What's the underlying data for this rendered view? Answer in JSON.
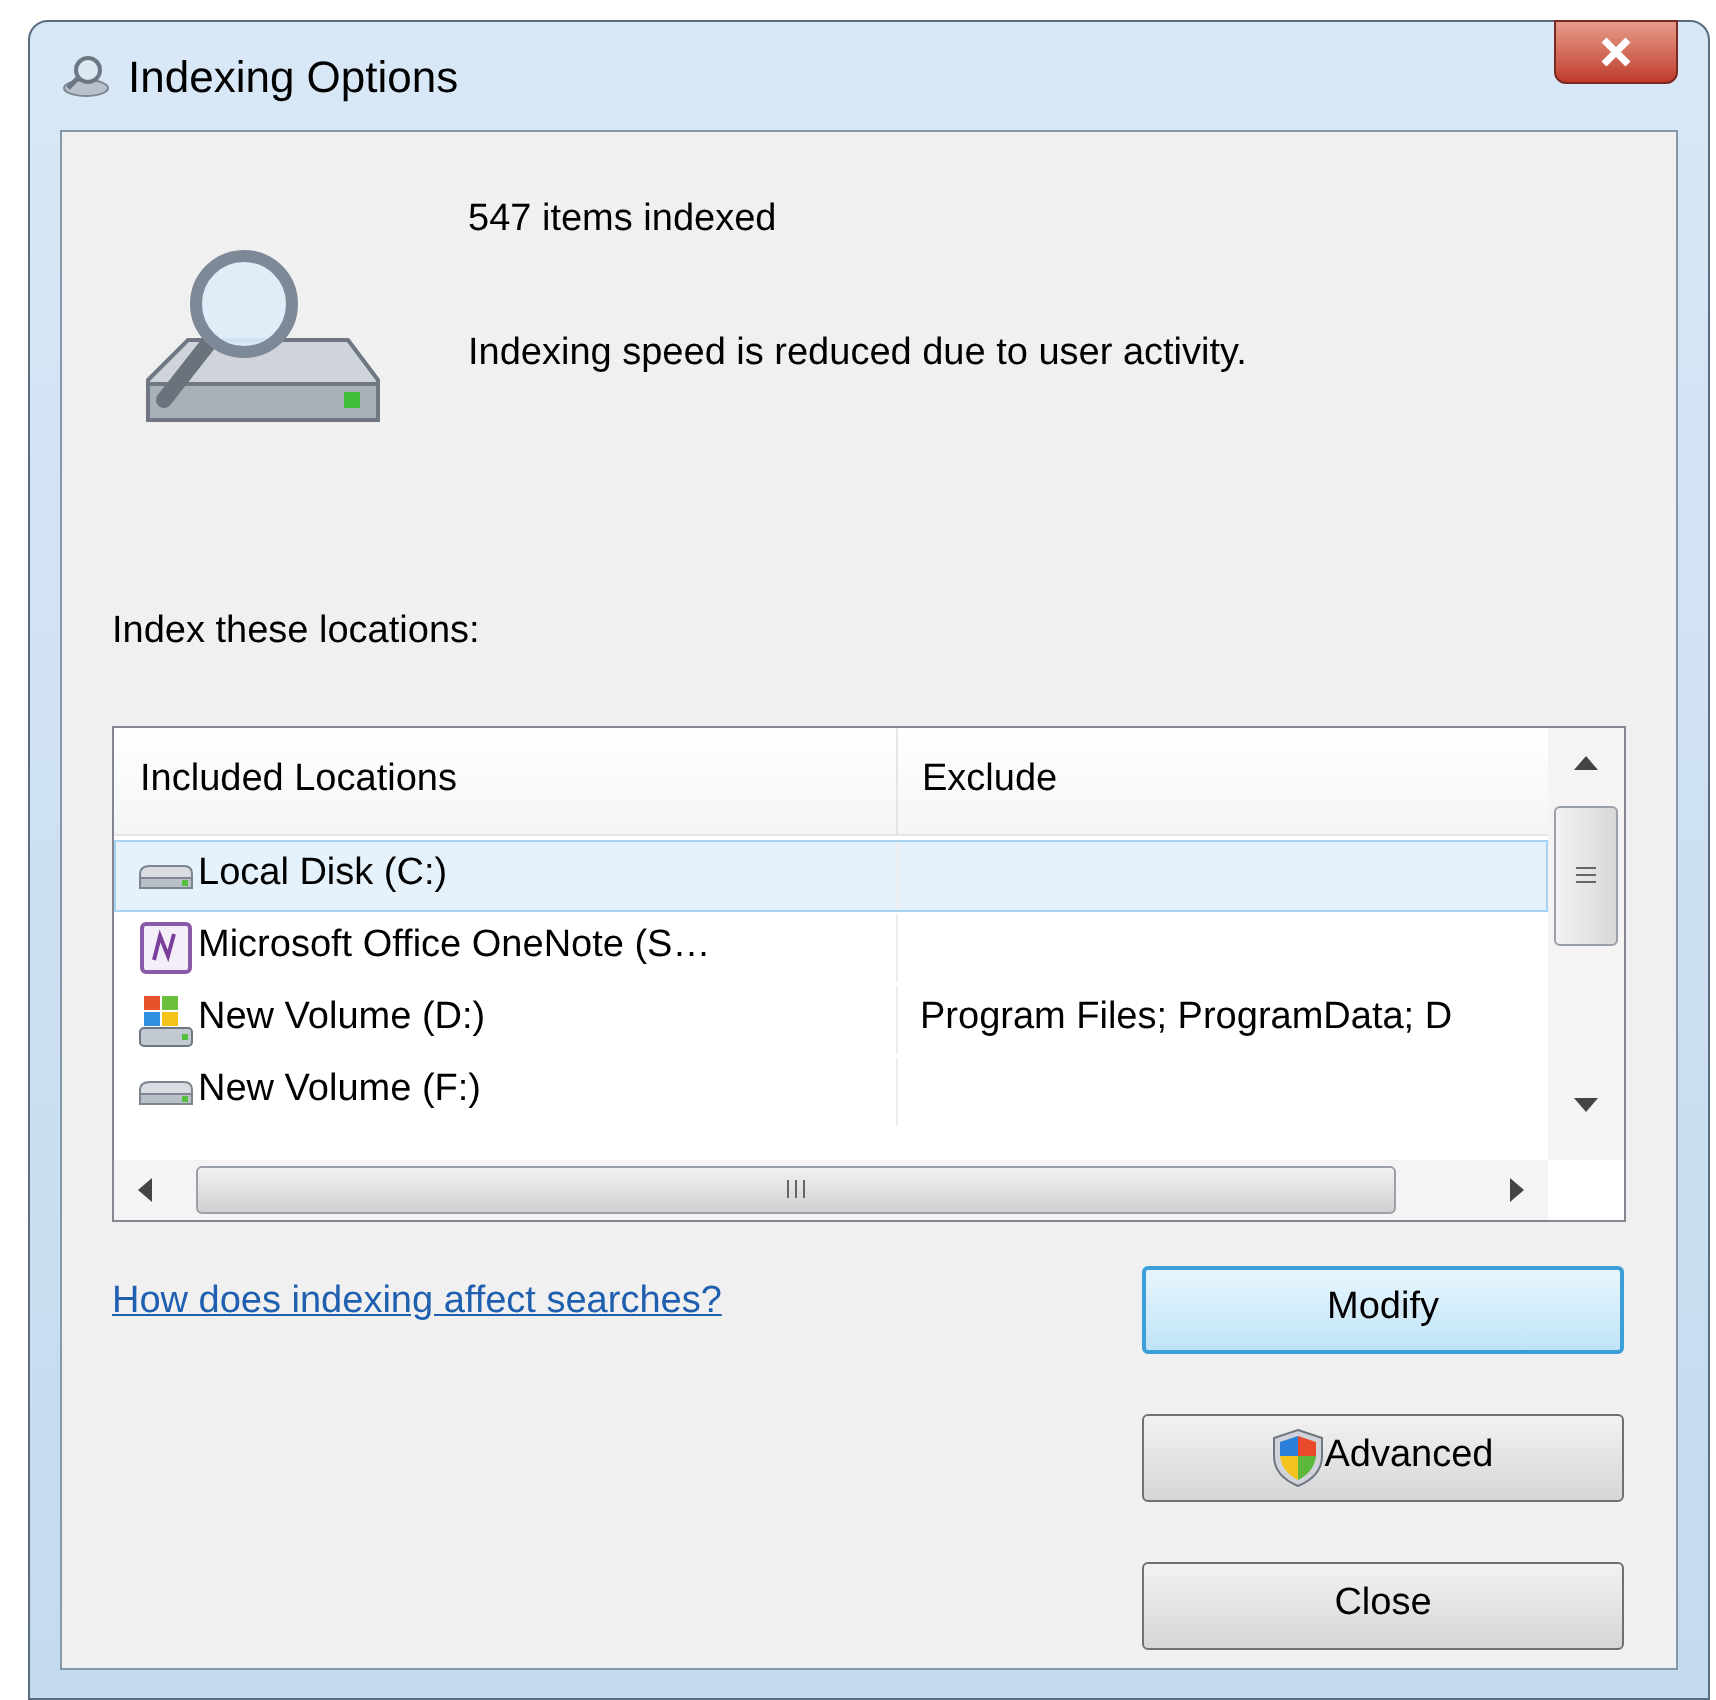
{
  "window": {
    "title": "Indexing Options"
  },
  "status": {
    "count": "547 items indexed",
    "message": "Indexing speed is reduced due to user activity."
  },
  "locations_label": "Index these locations:",
  "table": {
    "columns": [
      "Included Locations",
      "Exclude"
    ],
    "rows": [
      {
        "kind": "drive",
        "location": "Local Disk (C:)",
        "exclude": "",
        "selected": true
      },
      {
        "kind": "notebook",
        "location": "Microsoft Office OneNote (S…",
        "exclude": "",
        "selected": false
      },
      {
        "kind": "system-drive",
        "location": "New Volume (D:)",
        "exclude": "Program Files; ProgramData; D",
        "selected": false
      },
      {
        "kind": "drive",
        "location": "New Volume (F:)",
        "exclude": "",
        "selected": false
      }
    ]
  },
  "help_link": "How does indexing affect searches?",
  "buttons": [
    {
      "label": "Modify",
      "focused": true,
      "shield": false
    },
    {
      "label": "Advanced",
      "focused": false,
      "shield": true
    },
    {
      "label": "Close",
      "focused": false,
      "shield": false
    }
  ]
}
